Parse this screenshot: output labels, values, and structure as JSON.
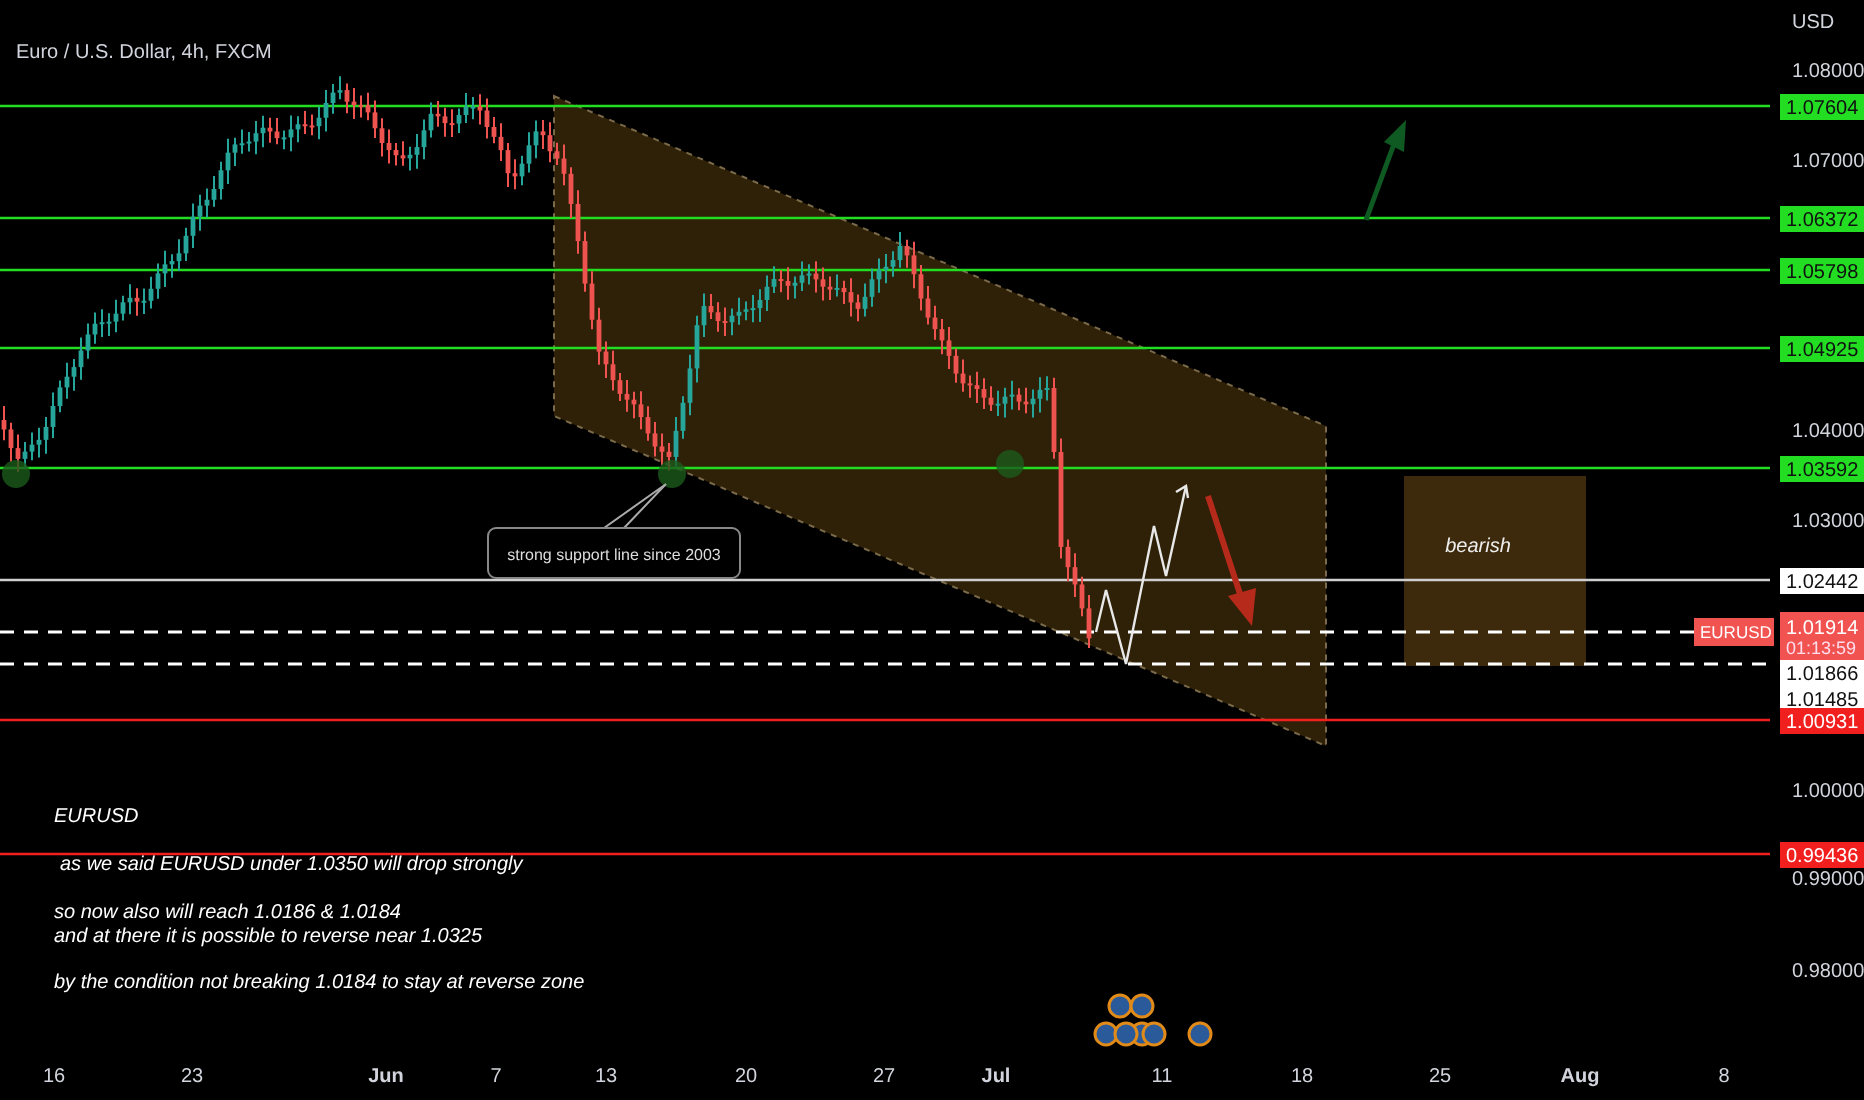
{
  "header": {
    "title": "Euro / U.S. Dollar, 4h, FXCM"
  },
  "price_axis": {
    "currency": "USD",
    "ticks": [
      "1.08000",
      "1.07000",
      "1.04000",
      "1.03000",
      "1.00000",
      "0.99000",
      "0.98000"
    ]
  },
  "levels": [
    {
      "kind": "solid",
      "price": "1.07604",
      "color": "#22dd22"
    },
    {
      "kind": "solid",
      "price": "1.06372",
      "color": "#22dd22"
    },
    {
      "kind": "solid",
      "price": "1.05798",
      "color": "#22dd22"
    },
    {
      "kind": "solid",
      "price": "1.04925",
      "color": "#22dd22"
    },
    {
      "kind": "solid",
      "price": "1.03592",
      "color": "#22dd22"
    },
    {
      "kind": "solid",
      "price": "1.02442",
      "color": "#ffffff"
    },
    {
      "kind": "current",
      "symbol": "EURUSD",
      "price": "1.01914",
      "countdown": "01:13:59",
      "color": "#f05350"
    },
    {
      "kind": "dashed",
      "price": "1.01866",
      "color": "#ffffff"
    },
    {
      "kind": "tag",
      "price": "1.01485",
      "color": "#ffffff"
    },
    {
      "kind": "solid",
      "price": "1.00931",
      "color": "#f21f1f"
    },
    {
      "kind": "solid",
      "price": "0.99436",
      "color": "#f21f1f"
    }
  ],
  "callout": {
    "text": "strong support line since 2003"
  },
  "zone": {
    "label": "bearish"
  },
  "note": [
    "EURUSD",
    "as we said EURUSD under 1.0350 will drop strongly",
    "so now also will reach 1.0186 & 1.0184",
    "and at there it is possible to reverse near 1.0325",
    "by the condition not breaking 1.0184 to stay at reverse zone"
  ],
  "time_axis": [
    {
      "label": "16",
      "month": false
    },
    {
      "label": "23",
      "month": false
    },
    {
      "label": "Jun",
      "month": true
    },
    {
      "label": "7",
      "month": false
    },
    {
      "label": "13",
      "month": false
    },
    {
      "label": "20",
      "month": false
    },
    {
      "label": "27",
      "month": false
    },
    {
      "label": "Jul",
      "month": true
    },
    {
      "label": "11",
      "month": false
    },
    {
      "label": "18",
      "month": false
    },
    {
      "label": "25",
      "month": false
    },
    {
      "label": "Aug",
      "month": true
    },
    {
      "label": "8",
      "month": false
    }
  ]
}
